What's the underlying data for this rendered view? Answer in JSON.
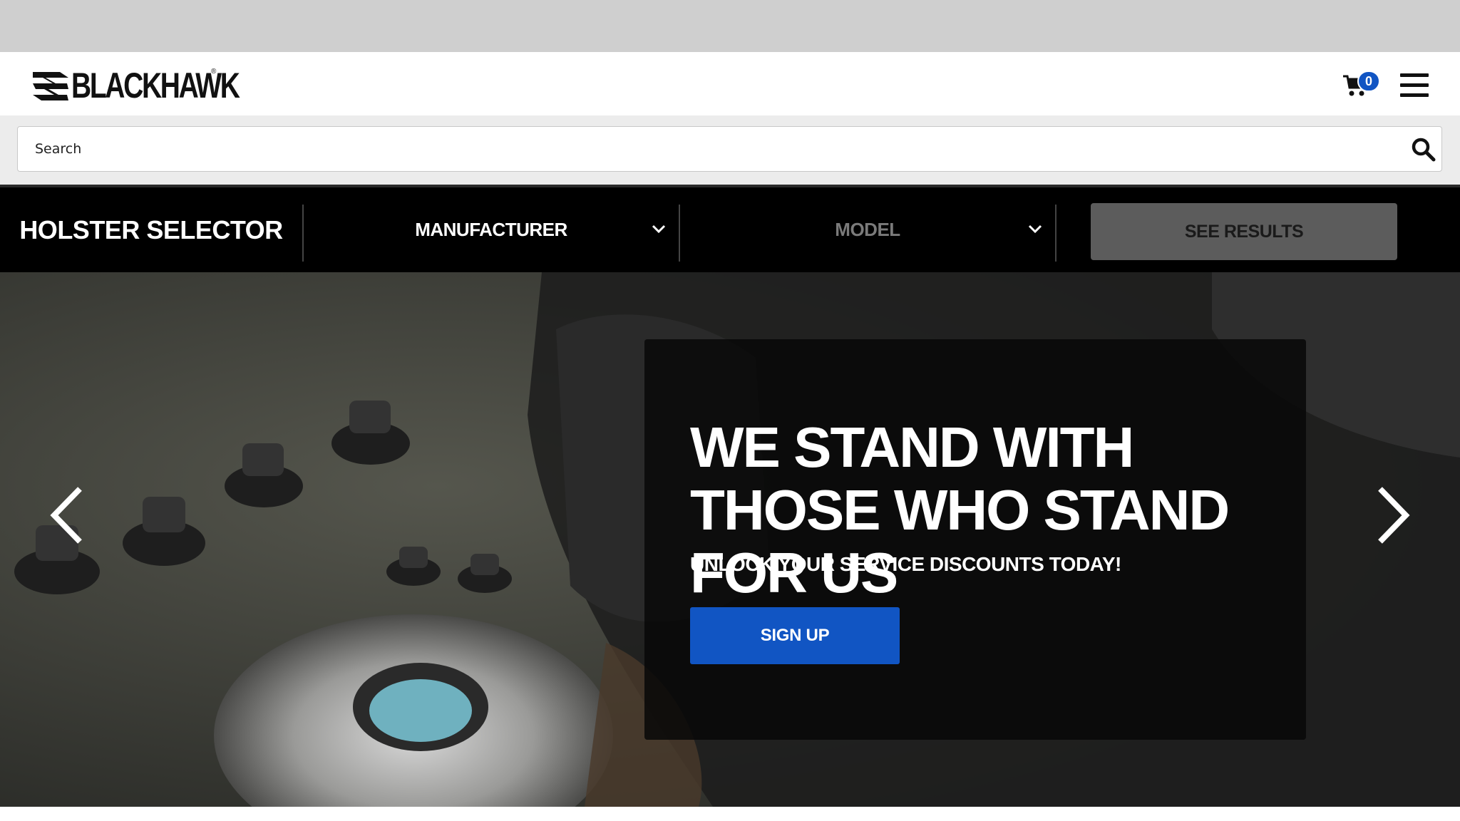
{
  "brand": {
    "name": "BLACKHAWK",
    "registered": "®"
  },
  "header": {
    "cart_count": "0",
    "icons": {
      "cart": "cart-icon",
      "menu": "hamburger-menu-icon"
    }
  },
  "search": {
    "placeholder": "Search",
    "value": "",
    "icon": "search-icon"
  },
  "holster_selector": {
    "title": "HOLSTER SELECTOR",
    "manufacturer_label": "MANUFACTURER",
    "model_label": "MODEL",
    "see_results_label": "SEE RESULTS",
    "colors": {
      "bar_bg": "#000000",
      "active_text": "#ffffff",
      "disabled_text": "#7a7a7a",
      "button_bg": "#5c5c5c"
    }
  },
  "hero": {
    "headline": "WE STAND WITH THOSE WHO STAND FOR US",
    "subheadline": "UNLOCK YOUR SERVICE DISCOUNTS TODAY!",
    "cta_label": "SIGN UP",
    "cta_color": "#1155c3",
    "prev_icon": "chevron-left-icon",
    "next_icon": "chevron-right-icon"
  }
}
